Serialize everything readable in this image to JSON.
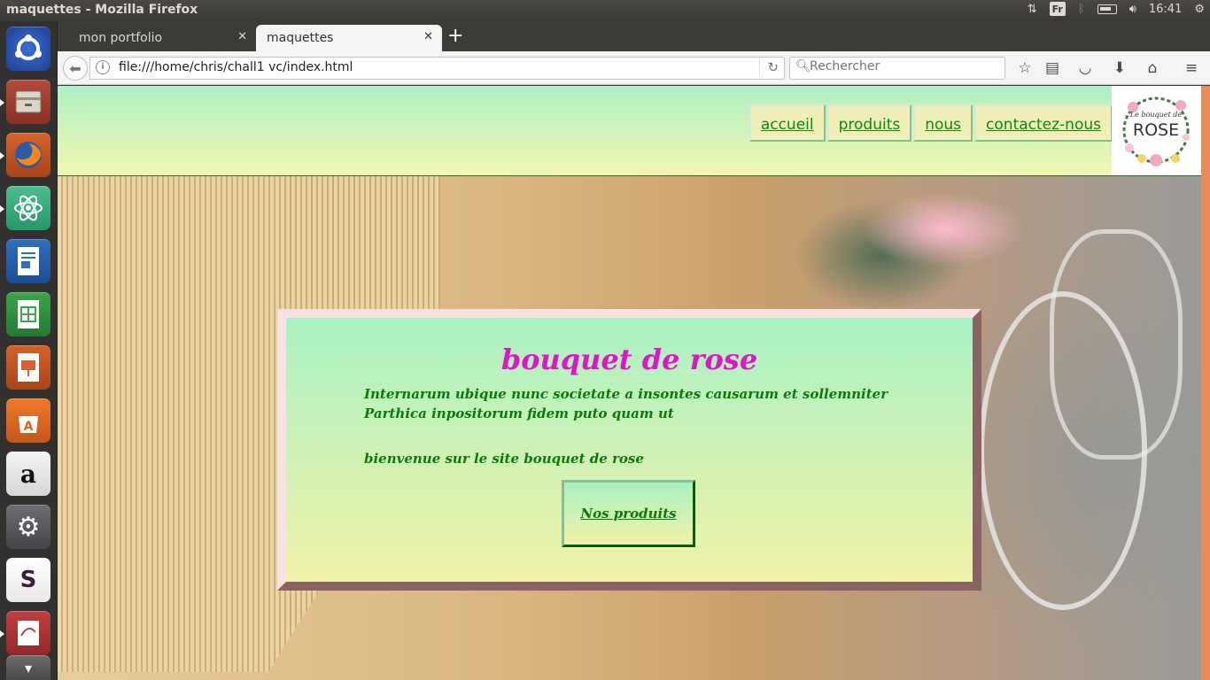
{
  "window": {
    "title": "maquettes - Mozilla Firefox"
  },
  "system": {
    "keyboard": "Fr",
    "time": "16:41"
  },
  "tabs": [
    {
      "label": "mon portfolio",
      "active": false
    },
    {
      "label": "maquettes",
      "active": true
    }
  ],
  "navbar": {
    "url": "file:///home/chris/chall1 vc/index.html",
    "search_placeholder": "Rechercher"
  },
  "launcher": {
    "apps": [
      "ubuntu-dash",
      "files",
      "firefox",
      "atom",
      "libreoffice-writer",
      "libreoffice-calc",
      "libreoffice-impress",
      "ubuntu-software",
      "amazon",
      "system-settings",
      "slack",
      "document-viewer",
      "trash"
    ]
  },
  "site": {
    "nav": [
      "accueil",
      "produits",
      "nous",
      "contactez-nous"
    ],
    "logo": {
      "line1": "Le bouquet de",
      "line2": "ROSE"
    },
    "title": "bouquet de rose",
    "lead": "Internarum ubique nunc societate a insontes causarum et sollemniter Parthica inpositorum fidem puto quam ut",
    "welcome": "bienvenue sur le site bouquet de rose",
    "cta": "Nos produits"
  },
  "colors": {
    "accent_green": "#0b8a0b",
    "title_magenta": "#e016c6",
    "header_gradient_top": "#aef0c3",
    "header_gradient_bottom": "#f2f7b3"
  }
}
